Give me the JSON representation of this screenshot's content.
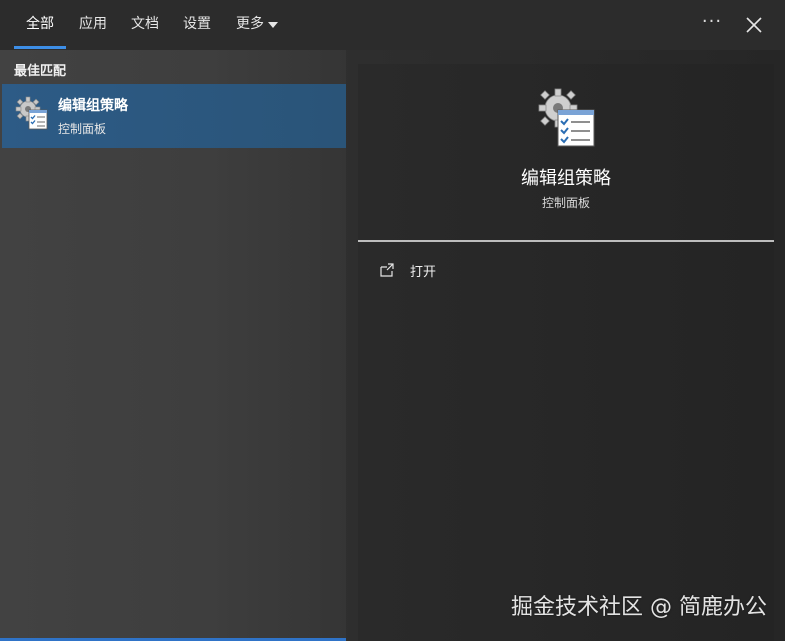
{
  "tabs": [
    {
      "label": "全部",
      "active": true
    },
    {
      "label": "应用",
      "active": false
    },
    {
      "label": "文档",
      "active": false
    },
    {
      "label": "设置",
      "active": false
    },
    {
      "label": "更多",
      "active": false
    }
  ],
  "header": {
    "more_options_icon": "ellipsis-icon",
    "more_options_label": "···",
    "close_icon": "close-icon"
  },
  "best_match": {
    "section_title": "最佳匹配",
    "title": "编辑组策略",
    "subtitle": "控制面板",
    "icon": "group-policy-icon"
  },
  "detail": {
    "title": "编辑组策略",
    "subtitle": "控制面板",
    "icon": "group-policy-icon",
    "actions": [
      {
        "label": "打开",
        "icon": "open-icon"
      }
    ]
  },
  "watermark": "掘金技术社区 @ 简鹿办公",
  "colors": {
    "accent": "#3d8ee6",
    "selection": "#2d5b86"
  }
}
